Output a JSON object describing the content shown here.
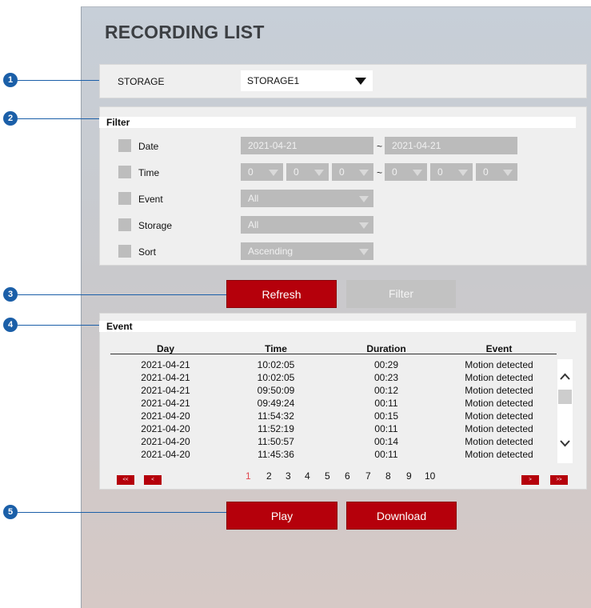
{
  "page": {
    "title": "RECORDING LIST"
  },
  "storage": {
    "label": "STORAGE",
    "value": "STORAGE1"
  },
  "filter": {
    "title": "Filter",
    "rows": [
      {
        "label": "Date"
      },
      {
        "label": "Time"
      },
      {
        "label": "Event"
      },
      {
        "label": "Storage"
      },
      {
        "label": "Sort"
      }
    ],
    "date_from": "2021-04-21",
    "date_to": "2021-04-21",
    "tilde": "~",
    "time_from": [
      "0",
      "0",
      "0"
    ],
    "time_to": [
      "0",
      "0",
      "0"
    ],
    "event_value": "All",
    "storage_value": "All",
    "sort_value": "Ascending"
  },
  "actions": {
    "refresh_label": "Refresh",
    "filter_label": "Filter"
  },
  "events": {
    "title": "Event",
    "columns": [
      "Day",
      "Time",
      "Duration",
      "Event"
    ],
    "rows": [
      [
        "2021-04-21",
        "10:02:05",
        "00:29",
        "Motion detected"
      ],
      [
        "2021-04-21",
        "10:02:05",
        "00:23",
        "Motion detected"
      ],
      [
        "2021-04-21",
        "09:50:09",
        "00:12",
        "Motion detected"
      ],
      [
        "2021-04-21",
        "09:49:24",
        "00:11",
        "Motion detected"
      ],
      [
        "2021-04-20",
        "11:54:32",
        "00:15",
        "Motion detected"
      ],
      [
        "2021-04-20",
        "11:52:19",
        "00:11",
        "Motion detected"
      ],
      [
        "2021-04-20",
        "11:50:57",
        "00:14",
        "Motion detected"
      ],
      [
        "2021-04-20",
        "11:45:36",
        "00:11",
        "Motion detected"
      ]
    ]
  },
  "pagination": {
    "first": "<<",
    "prev": "<",
    "next": ">",
    "last": ">>",
    "pages": [
      "1",
      "2",
      "3",
      "4",
      "5",
      "6",
      "7",
      "8",
      "9",
      "10"
    ],
    "current": "1"
  },
  "footer": {
    "play_label": "Play",
    "download_label": "Download"
  },
  "callouts": [
    "1",
    "2",
    "3",
    "4",
    "5"
  ],
  "colors": {
    "accent_red": "#b5000b",
    "callout_blue": "#1b5fa8",
    "active_page": "#e0484f"
  }
}
